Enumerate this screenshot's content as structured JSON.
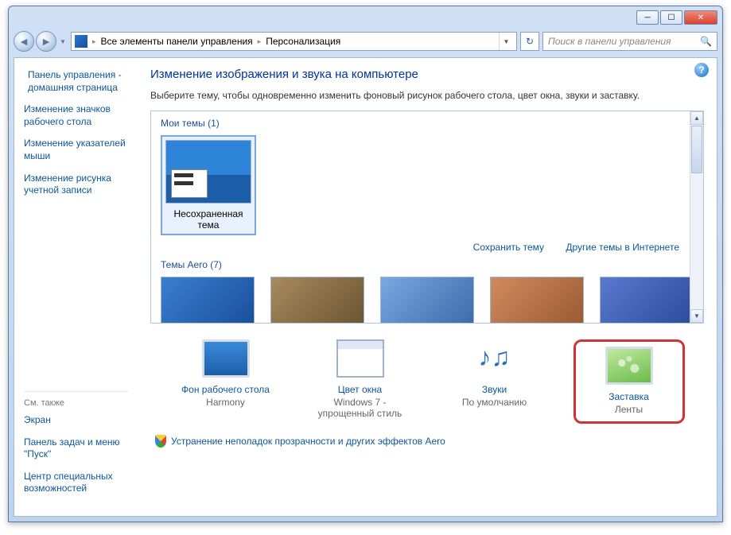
{
  "breadcrumb": {
    "item1": "Все элементы панели управления",
    "item2": "Персонализация"
  },
  "search": {
    "placeholder": "Поиск в панели управления"
  },
  "sidebar": {
    "home": "Панель управления - домашняя страница",
    "links": [
      "Изменение значков рабочего стола",
      "Изменение указателей мыши",
      "Изменение рисунка учетной записи"
    ],
    "see_also_label": "См. также",
    "see_also": [
      "Экран",
      "Панель задач и меню \"Пуск\"",
      "Центр специальных возможностей"
    ]
  },
  "main": {
    "title": "Изменение изображения и звука на компьютере",
    "desc": "Выберите тему, чтобы одновременно изменить фоновый рисунок рабочего стола, цвет окна, звуки и заставку.",
    "my_themes_label": "Мои темы (1)",
    "unsaved_theme": "Несохраненная тема",
    "save_theme": "Сохранить тему",
    "online_themes": "Другие темы в Интернете",
    "aero_label": "Темы Aero (7)"
  },
  "bottom": {
    "desktop_bg": {
      "label": "Фон рабочего стола",
      "value": "Harmony"
    },
    "window_color": {
      "label": "Цвет окна",
      "value": "Windows 7 - упрощенный стиль"
    },
    "sounds": {
      "label": "Звуки",
      "value": "По умолчанию"
    },
    "screensaver": {
      "label": "Заставка",
      "value": "Ленты"
    }
  },
  "footer": {
    "aero_troubleshoot": "Устранение неполадок прозрачности и других эффектов Aero"
  }
}
